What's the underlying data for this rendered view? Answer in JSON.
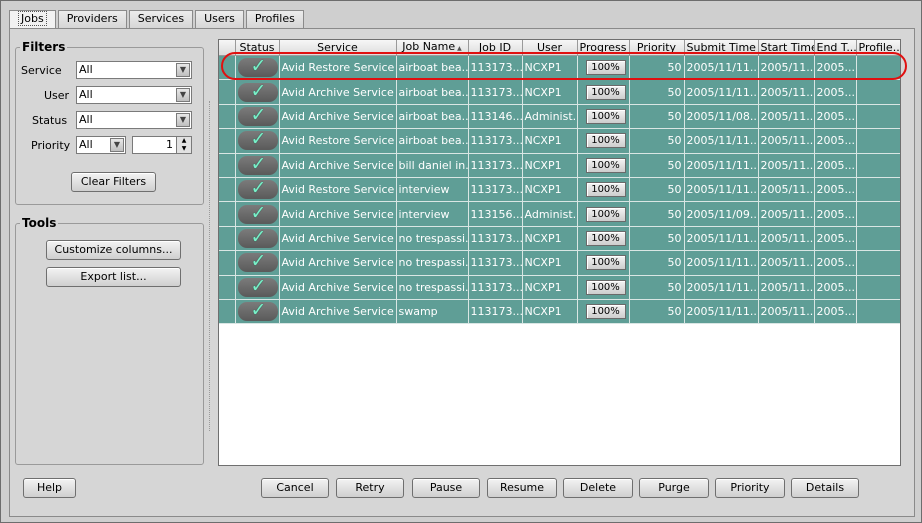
{
  "tabs": [
    {
      "label": "Jobs"
    },
    {
      "label": "Providers"
    },
    {
      "label": "Services"
    },
    {
      "label": "Users"
    },
    {
      "label": "Profiles"
    }
  ],
  "filters": {
    "title": "Filters",
    "service_label": "Service",
    "service_value": "All",
    "user_label": "User",
    "user_value": "All",
    "status_label": "Status",
    "status_value": "All",
    "priority_label": "Priority",
    "priority_value": "All",
    "priority_number": "1",
    "clear_button": "Clear Filters"
  },
  "tools": {
    "title": "Tools",
    "customize_button": "Customize columns...",
    "export_button": "Export list..."
  },
  "table": {
    "columns": [
      "Status",
      "Service",
      "Job Name",
      "Job ID",
      "User",
      "Progress",
      "Priority",
      "Submit Time",
      "Start Time",
      "End T...",
      "Profile..."
    ],
    "sort_indicator": "▲",
    "rows": [
      {
        "service": "Avid Restore Service",
        "job_name": "airboat bea...",
        "job_id": "113173...",
        "user": "NCXP1",
        "progress": "100%",
        "priority": "50",
        "submit": "2005/11/11...",
        "start": "2005/11...",
        "end": "2005...",
        "profile": ""
      },
      {
        "service": "Avid Archive Service",
        "job_name": "airboat bea...",
        "job_id": "113173...",
        "user": "NCXP1",
        "progress": "100%",
        "priority": "50",
        "submit": "2005/11/11...",
        "start": "2005/11...",
        "end": "2005...",
        "profile": ""
      },
      {
        "service": "Avid Archive Service",
        "job_name": "airboat bea...",
        "job_id": "113146...",
        "user": "Administ...",
        "progress": "100%",
        "priority": "50",
        "submit": "2005/11/08...",
        "start": "2005/11...",
        "end": "2005...",
        "profile": ""
      },
      {
        "service": "Avid Restore Service",
        "job_name": "airboat bea...",
        "job_id": "113173...",
        "user": "NCXP1",
        "progress": "100%",
        "priority": "50",
        "submit": "2005/11/11...",
        "start": "2005/11...",
        "end": "2005...",
        "profile": ""
      },
      {
        "service": "Avid Archive Service",
        "job_name": "bill daniel in...",
        "job_id": "113173...",
        "user": "NCXP1",
        "progress": "100%",
        "priority": "50",
        "submit": "2005/11/11...",
        "start": "2005/11...",
        "end": "2005...",
        "profile": ""
      },
      {
        "service": "Avid Restore Service",
        "job_name": "interview",
        "job_id": "113173...",
        "user": "NCXP1",
        "progress": "100%",
        "priority": "50",
        "submit": "2005/11/11...",
        "start": "2005/11...",
        "end": "2005...",
        "profile": ""
      },
      {
        "service": "Avid Archive Service",
        "job_name": "interview",
        "job_id": "113156...",
        "user": "Administ...",
        "progress": "100%",
        "priority": "50",
        "submit": "2005/11/09...",
        "start": "2005/11...",
        "end": "2005...",
        "profile": ""
      },
      {
        "service": "Avid Archive Service",
        "job_name": "no trespassi...",
        "job_id": "113173...",
        "user": "NCXP1",
        "progress": "100%",
        "priority": "50",
        "submit": "2005/11/11...",
        "start": "2005/11...",
        "end": "2005...",
        "profile": ""
      },
      {
        "service": "Avid Archive Service",
        "job_name": "no trespassi...",
        "job_id": "113173...",
        "user": "NCXP1",
        "progress": "100%",
        "priority": "50",
        "submit": "2005/11/11...",
        "start": "2005/11...",
        "end": "2005...",
        "profile": ""
      },
      {
        "service": "Avid Archive Service",
        "job_name": "no trespassi...",
        "job_id": "113173...",
        "user": "NCXP1",
        "progress": "100%",
        "priority": "50",
        "submit": "2005/11/11...",
        "start": "2005/11...",
        "end": "2005...",
        "profile": ""
      },
      {
        "service": "Avid Archive Service",
        "job_name": "swamp",
        "job_id": "113173...",
        "user": "NCXP1",
        "progress": "100%",
        "priority": "50",
        "submit": "2005/11/11...",
        "start": "2005/11...",
        "end": "2005...",
        "profile": ""
      }
    ]
  },
  "bottom": {
    "help": "Help",
    "cancel": "Cancel",
    "retry": "Retry",
    "pause": "Pause",
    "resume": "Resume",
    "delete": "Delete",
    "purge": "Purge",
    "priority": "Priority",
    "details": "Details"
  },
  "colors": {
    "row_bg": "#5f9e96",
    "highlight": "#e01010",
    "check": "#7af0c8"
  },
  "icons": {
    "status": "checkmark-icon",
    "dropdown": "chevron-down-icon"
  }
}
